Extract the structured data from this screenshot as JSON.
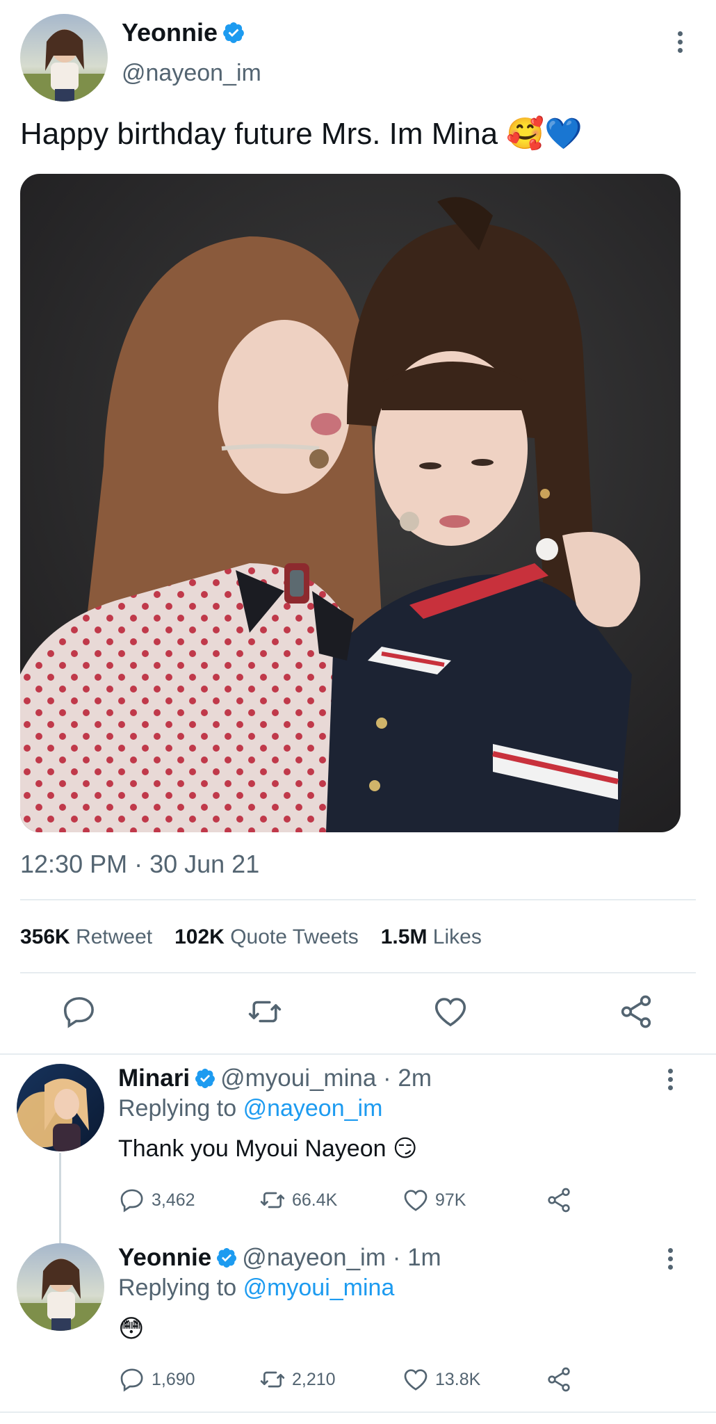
{
  "main_tweet": {
    "display_name": "Yeonnie",
    "handle": "@nayeon_im",
    "text": "Happy birthday future Mrs. Im Mina",
    "emoji": "🥰💙",
    "timestamp": "12:30 PM · 30 Jun 21",
    "stats": [
      {
        "value": "356K",
        "label": "Retweet"
      },
      {
        "value": "102K",
        "label": "Quote Tweets"
      },
      {
        "value": "1.5M",
        "label": "Likes"
      }
    ],
    "actions": [
      "reply-icon",
      "retweet-icon",
      "like-icon",
      "share-icon"
    ]
  },
  "replies": [
    {
      "display_name": "Minari",
      "handle_time": "@myoui_mina · 2m",
      "replying_prefix": "Replying to",
      "replying_to": "@nayeon_im",
      "text": "Thank you Myoui Nayeon 😏",
      "reply_count": "3,462",
      "retweet_count": "66.4K",
      "like_count": "97K"
    },
    {
      "display_name": "Yeonnie",
      "handle_time": "@nayeon_im · 1m",
      "replying_prefix": "Replying to",
      "replying_to": "@myoui_mina",
      "text": "😳",
      "reply_count": "1,690",
      "retweet_count": "2,210",
      "like_count": "13.8K"
    }
  ],
  "colors": {
    "accent": "#1d9bf0",
    "muted": "#536471",
    "divider": "#e6ecf0"
  }
}
